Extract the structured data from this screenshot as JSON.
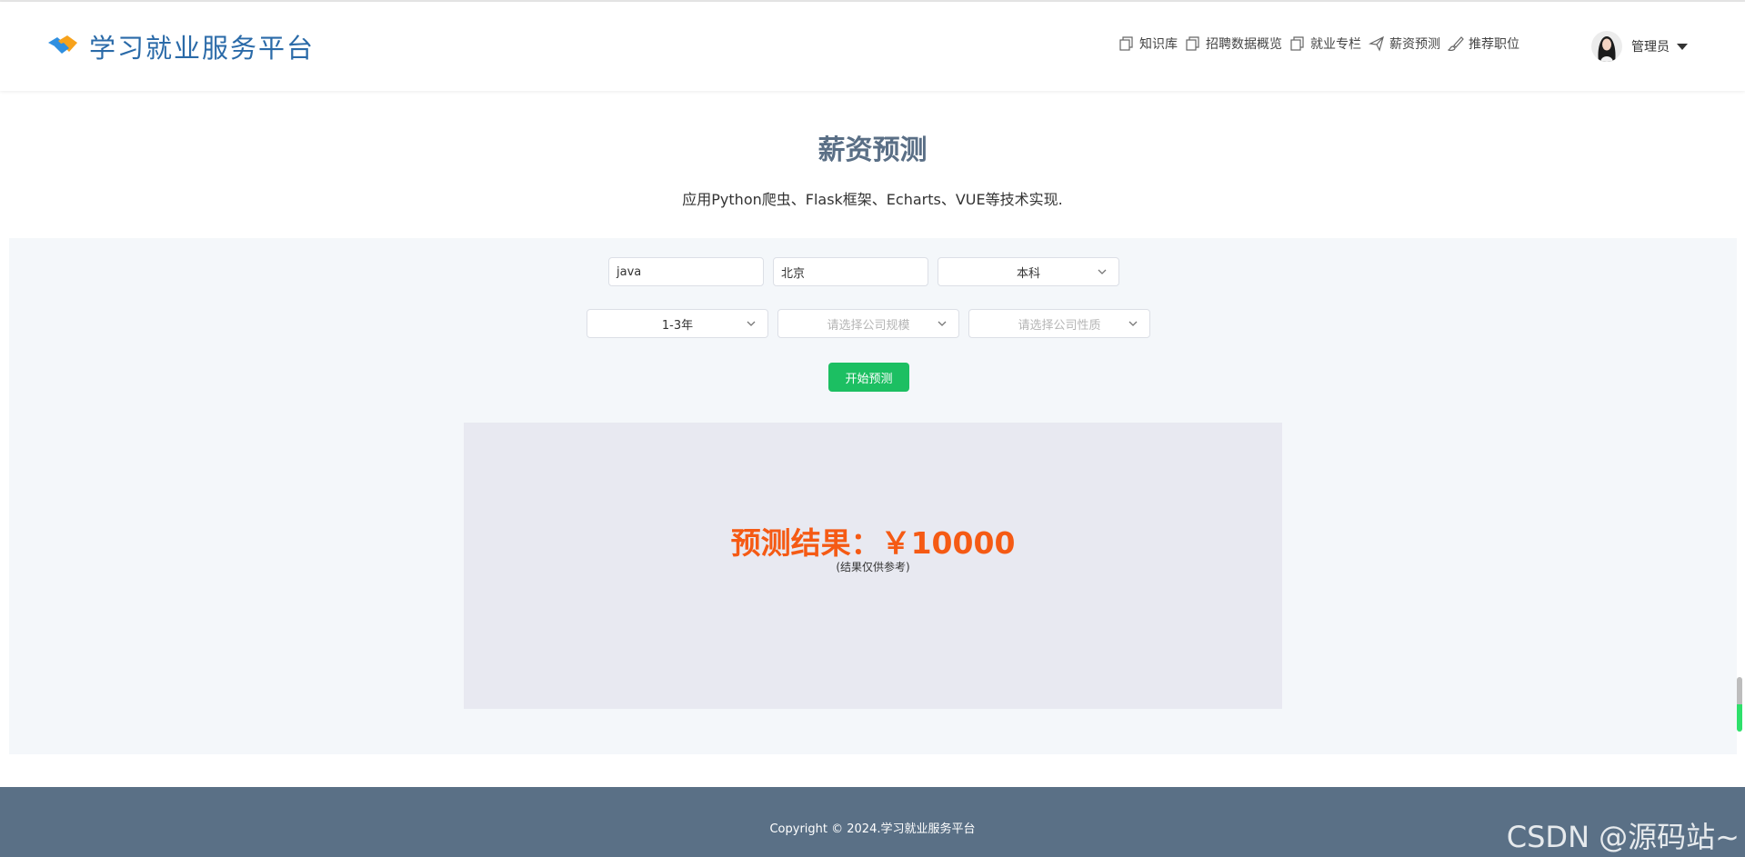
{
  "header": {
    "brand": "学习就业服务平台",
    "nav": [
      {
        "label": "知识库",
        "icon": "copy-icon"
      },
      {
        "label": "招聘数据概览",
        "icon": "copy-icon"
      },
      {
        "label": "就业专栏",
        "icon": "copy-icon"
      },
      {
        "label": "薪资预测",
        "icon": "send-icon"
      },
      {
        "label": "推荐职位",
        "icon": "brush-icon"
      }
    ],
    "user": {
      "name": "管理员"
    }
  },
  "page": {
    "title": "薪资预测",
    "subtitle": "应用Python爬虫、Flask框架、Echarts、VUE等技术实现."
  },
  "form": {
    "job": "java",
    "city": "北京",
    "education": "本科",
    "experience": "1-3年",
    "company_size_placeholder": "请选择公司规模",
    "company_type_placeholder": "请选择公司性质",
    "submit_label": "开始预测"
  },
  "result": {
    "text": "预测结果：￥10000",
    "note": "(结果仅供参考)"
  },
  "footer": {
    "copyright": "Copyright © 2024.学习就业服务平台",
    "watermark": "CSDN @源码站~"
  },
  "colors": {
    "brand": "#2a6aa8",
    "accent_green": "#1cbf62",
    "result_orange": "#f55a14",
    "footer_bg": "#5a7086"
  }
}
